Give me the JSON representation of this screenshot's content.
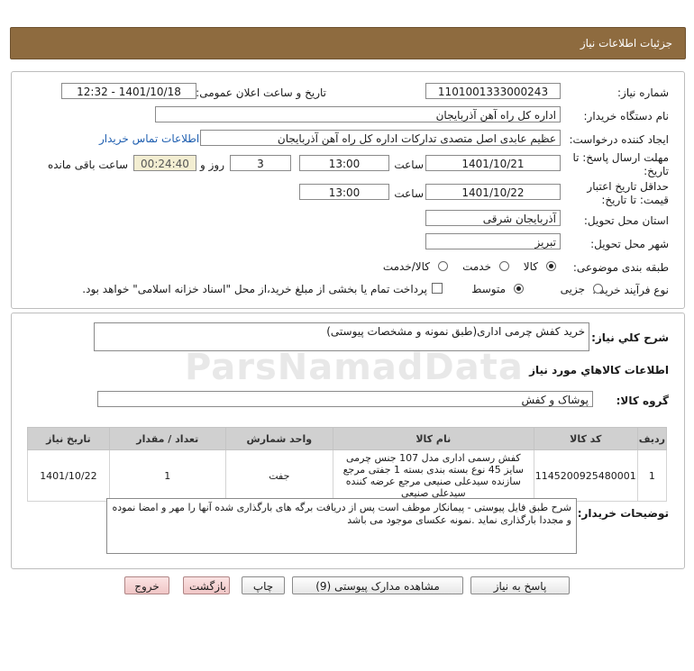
{
  "header": {
    "title": "جزئیات اطلاعات نیاز"
  },
  "labels": {
    "need_number": "شماره نیاز:",
    "announce_datetime": "تاریخ و ساعت اعلان عمومی:",
    "buyer_org": "نام دستگاه خریدار:",
    "requester": "ایجاد کننده درخواست:",
    "reply_deadline": "مهلت ارسال پاسخ: تا تاریخ:",
    "time": "ساعت",
    "day_and": "روز و",
    "remaining": "ساعت باقی مانده",
    "price_validity": "حداقل تاریخ اعتبار قیمت: تا تاریخ:",
    "delivery_province": "استان محل تحویل:",
    "delivery_city": "شهر محل تحویل:",
    "category": "طبقه بندی موضوعی:",
    "purchase_process": "نوع فرآیند خرید :",
    "overall_desc": "شرح کلي نياز:",
    "goods_info": "اطلاعات کالاهاي مورد نياز",
    "goods_group": "گروه کالا:",
    "buyer_notes": "توضیحات خریدار:"
  },
  "values": {
    "need_number": "1101001333000243",
    "announce_datetime": "1401/10/18 - 12:32",
    "buyer_org": "اداره کل راه آهن آذربایجان",
    "requester": "عظیم عابدی اصل متصدی تدارکات اداره کل راه آهن آذربایجان",
    "contact_link": "اطلاعات تماس خریدار",
    "reply_date": "1401/10/21",
    "reply_time": "13:00",
    "reply_days": "3",
    "reply_remaining": "00:24:40",
    "validity_date": "1401/10/22",
    "validity_time": "13:00",
    "province": "آذربایجان شرقی",
    "city": "تبریز",
    "overall_desc": "خرید کفش چرمی اداری(طبق نمونه و مشخصات پیوستی)",
    "goods_group": "پوشاک و کفش",
    "buyer_notes": "شرح طبق فایل پیوستی - پیمانکار موظف است  پس از دریافت برگه های بارگذاری شده آنها را مهر و امضا نموده و مجددا بارگذاری نماید .نمونه عکسای موجود می باشد"
  },
  "category_options": [
    {
      "label": "کالا",
      "selected": true
    },
    {
      "label": "خدمت",
      "selected": false
    },
    {
      "label": "کالا/خدمت",
      "selected": false
    }
  ],
  "process_options": [
    {
      "label": "جزیی",
      "selected": false
    },
    {
      "label": "متوسط",
      "selected": true
    }
  ],
  "payment_note": "پرداخت تمام یا بخشی از مبلغ خرید،از محل \"اسناد خزانه اسلامی\" خواهد بود.",
  "table": {
    "headers": [
      "ردیف",
      "کد کالا",
      "نام کالا",
      "واحد شمارش",
      "تعداد / مقدار",
      "تاریخ نیاز"
    ],
    "rows": [
      {
        "row": "1",
        "code": "1145200925480001",
        "name": "کفش رسمی اداری مدل 107 جنس چرمی سایز 45 نوع بسته بندی بسته 1 جفتی مرجع سازنده سیدعلی صنیعی مرجع عرضه کننده سیدعلی صنیعی",
        "unit": "جفت",
        "qty": "1",
        "date": "1401/10/22"
      }
    ]
  },
  "buttons": {
    "reply": "پاسخ به نیاز",
    "attachments": "مشاهده مدارک پیوستی (9)",
    "print": "چاپ",
    "back": "بازگشت",
    "exit": "خروج"
  },
  "watermark": "ParsNamadData"
}
